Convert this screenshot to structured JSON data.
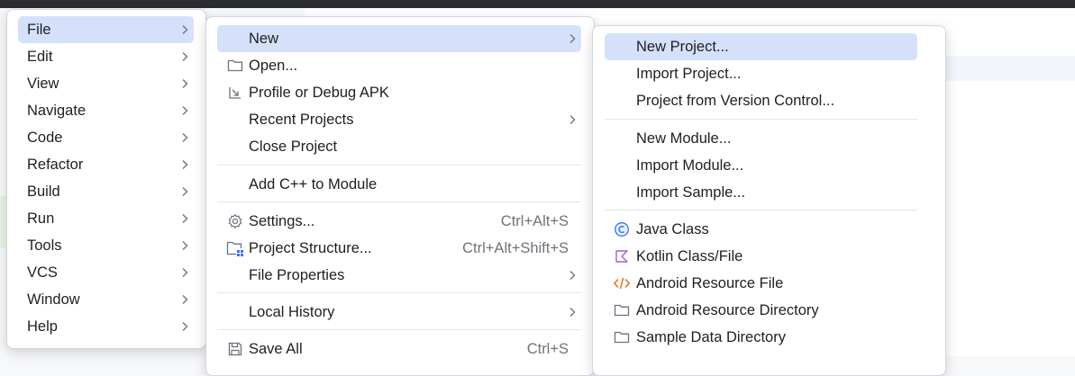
{
  "main_menu": {
    "items": [
      {
        "label": "File",
        "selected": true
      },
      {
        "label": "Edit"
      },
      {
        "label": "View"
      },
      {
        "label": "Navigate"
      },
      {
        "label": "Code"
      },
      {
        "label": "Refactor"
      },
      {
        "label": "Build"
      },
      {
        "label": "Run"
      },
      {
        "label": "Tools"
      },
      {
        "label": "VCS"
      },
      {
        "label": "Window"
      },
      {
        "label": "Help"
      }
    ]
  },
  "file_menu": {
    "new": "New",
    "open": "Open...",
    "profile_debug_apk": "Profile or Debug APK",
    "recent_projects": "Recent Projects",
    "close_project": "Close Project",
    "add_cpp_module": "Add C++ to Module",
    "settings": "Settings...",
    "settings_shortcut": "Ctrl+Alt+S",
    "project_structure": "Project Structure...",
    "project_structure_shortcut": "Ctrl+Alt+Shift+S",
    "file_properties": "File Properties",
    "local_history": "Local History",
    "save_all": "Save All",
    "save_all_shortcut": "Ctrl+S"
  },
  "new_menu": {
    "new_project": "New Project...",
    "import_project": "Import Project...",
    "project_from_vcs": "Project from Version Control...",
    "new_module": "New Module...",
    "import_module": "Import Module...",
    "import_sample": "Import Sample...",
    "java_class": "Java Class",
    "kotlin_class_file": "Kotlin Class/File",
    "android_resource_file": "Android Resource File",
    "android_resource_directory": "Android Resource Directory",
    "sample_data_directory": "Sample Data Directory"
  },
  "colors": {
    "selection": "#d5e1fb",
    "java_icon": "#3574f0",
    "kotlin_icon": "#a55be0",
    "xml_icon": "#e8701a"
  }
}
